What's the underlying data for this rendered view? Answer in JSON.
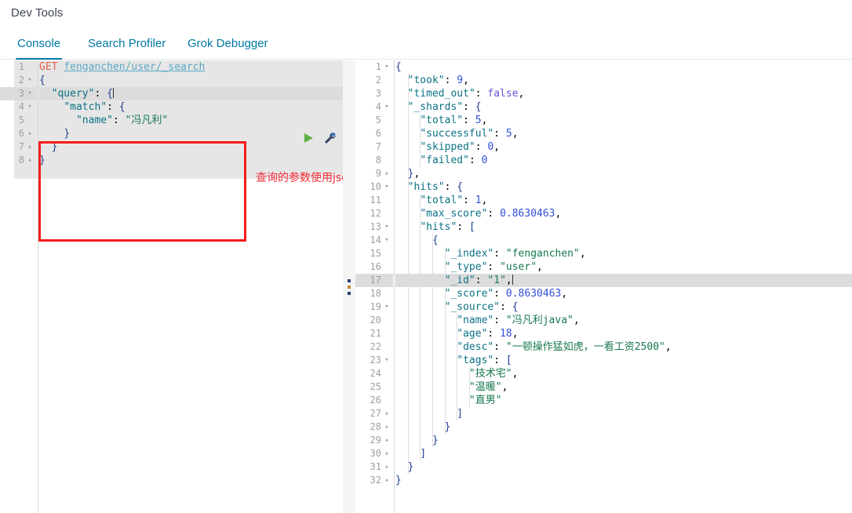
{
  "app": {
    "title": "Dev Tools"
  },
  "tabs": [
    {
      "label": "Console",
      "active": true
    },
    {
      "label": "Search Profiler",
      "active": false
    },
    {
      "label": "Grok Debugger",
      "active": false
    }
  ],
  "request": {
    "method": "GET",
    "path": "fenganchen/user/_search",
    "run_icon": "play-icon",
    "settings_icon": "wrench-icon",
    "highlighted_line": 3,
    "lines": [
      {
        "n": 1,
        "fold": "",
        "text": ""
      },
      {
        "n": 2,
        "fold": "▾",
        "text": "{"
      },
      {
        "n": 3,
        "fold": "▾",
        "text": "  \"query\": {"
      },
      {
        "n": 4,
        "fold": "▾",
        "text": "    \"match\": {"
      },
      {
        "n": 5,
        "fold": "",
        "text": "      \"name\": \"冯凡利\""
      },
      {
        "n": 6,
        "fold": "▴",
        "text": "    }"
      },
      {
        "n": 7,
        "fold": "▴",
        "text": "  }"
      },
      {
        "n": 8,
        "fold": "▴",
        "text": "}"
      }
    ]
  },
  "annotation": {
    "text": "查询的参数使用json 构造",
    "color": "#f4303a",
    "box_color": "#f41c1c"
  },
  "splitter": {
    "name": "panel-resize-handle"
  },
  "response": {
    "highlighted_line": 17,
    "lines": [
      {
        "n": 1,
        "fold": "▾",
        "text": "{"
      },
      {
        "n": 2,
        "fold": "",
        "text": "  \"took\": 9,"
      },
      {
        "n": 3,
        "fold": "",
        "text": "  \"timed_out\": false,"
      },
      {
        "n": 4,
        "fold": "▾",
        "text": "  \"_shards\": {"
      },
      {
        "n": 5,
        "fold": "",
        "text": "    \"total\": 5,"
      },
      {
        "n": 6,
        "fold": "",
        "text": "    \"successful\": 5,"
      },
      {
        "n": 7,
        "fold": "",
        "text": "    \"skipped\": 0,"
      },
      {
        "n": 8,
        "fold": "",
        "text": "    \"failed\": 0"
      },
      {
        "n": 9,
        "fold": "▴",
        "text": "  },"
      },
      {
        "n": 10,
        "fold": "▾",
        "text": "  \"hits\": {"
      },
      {
        "n": 11,
        "fold": "",
        "text": "    \"total\": 1,"
      },
      {
        "n": 12,
        "fold": "",
        "text": "    \"max_score\": 0.8630463,"
      },
      {
        "n": 13,
        "fold": "▾",
        "text": "    \"hits\": ["
      },
      {
        "n": 14,
        "fold": "▾",
        "text": "      {"
      },
      {
        "n": 15,
        "fold": "",
        "text": "        \"_index\": \"fenganchen\","
      },
      {
        "n": 16,
        "fold": "",
        "text": "        \"_type\": \"user\","
      },
      {
        "n": 17,
        "fold": "",
        "text": "        \"_id\": \"1\","
      },
      {
        "n": 18,
        "fold": "",
        "text": "        \"_score\": 0.8630463,"
      },
      {
        "n": 19,
        "fold": "▾",
        "text": "        \"_source\": {"
      },
      {
        "n": 20,
        "fold": "",
        "text": "          \"name\": \"冯凡利java\","
      },
      {
        "n": 21,
        "fold": "",
        "text": "          \"age\": 18,"
      },
      {
        "n": 22,
        "fold": "",
        "text": "          \"desc\": \"一顿操作猛如虎，一看工资2500\","
      },
      {
        "n": 23,
        "fold": "▾",
        "text": "          \"tags\": ["
      },
      {
        "n": 24,
        "fold": "",
        "text": "            \"技术宅\","
      },
      {
        "n": 25,
        "fold": "",
        "text": "            \"温暖\","
      },
      {
        "n": 26,
        "fold": "",
        "text": "            \"直男\""
      },
      {
        "n": 27,
        "fold": "▴",
        "text": "          ]"
      },
      {
        "n": 28,
        "fold": "▴",
        "text": "        }"
      },
      {
        "n": 29,
        "fold": "▴",
        "text": "      }"
      },
      {
        "n": 30,
        "fold": "▴",
        "text": "    ]"
      },
      {
        "n": 31,
        "fold": "▴",
        "text": "  }"
      },
      {
        "n": 32,
        "fold": "▴",
        "text": "}"
      }
    ]
  },
  "colors": {
    "accent": "#0079a5",
    "method": "#e8614d",
    "url": "#5aa7c4",
    "key": "#0b7285",
    "string": "#17794e",
    "number": "#2f4fd8",
    "boolean": "#6b4fd8",
    "editor_bg": "#e6e6e6",
    "highlight": "#dcdcdc"
  }
}
